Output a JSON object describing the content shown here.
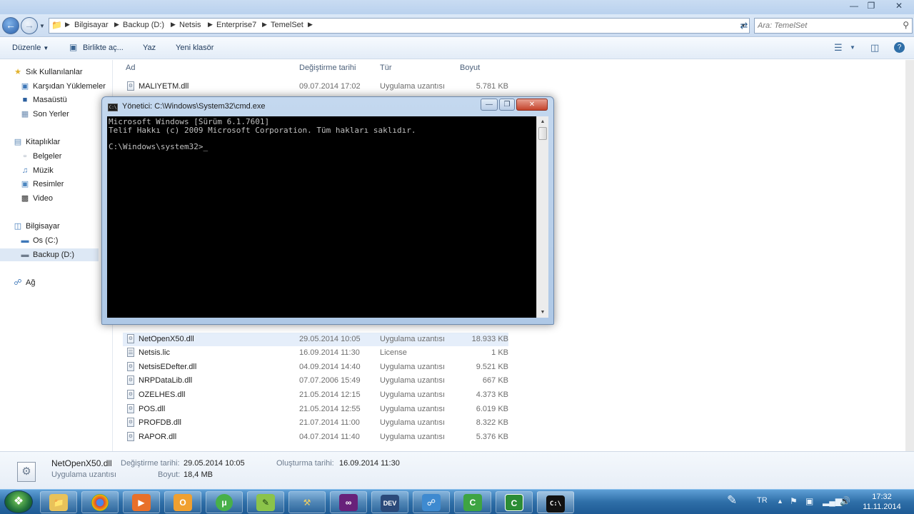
{
  "explorer": {
    "breadcrumbs": [
      "Bilgisayar",
      "Backup (D:)",
      "Netsis",
      "Enterprise7",
      "TemelSet"
    ],
    "search_placeholder": "Ara: TemelSet",
    "toolbar": {
      "organize": "Düzenle",
      "open_with": "Birlikte aç...",
      "print": "Yaz",
      "new_folder": "Yeni klasör"
    },
    "nav": {
      "favorites": "Sık Kullanılanlar",
      "downloads": "Karşıdan Yüklemeler",
      "desktop": "Masaüstü",
      "recent": "Son Yerler",
      "libraries": "Kitaplıklar",
      "documents": "Belgeler",
      "music": "Müzik",
      "pictures": "Resimler",
      "videos": "Video",
      "computer": "Bilgisayar",
      "drive_c": "Os (C:)",
      "drive_d": "Backup (D:)",
      "network": "Ağ"
    },
    "columns": {
      "name": "Ad",
      "date": "Değiştirme tarihi",
      "type": "Tür",
      "size": "Boyut"
    },
    "files": [
      {
        "name": "MALIYETM.dll",
        "date": "09.07.2014 17:02",
        "type": "Uygulama uzantısı",
        "size": "5.781 KB"
      },
      {
        "name": "NetOpenX50.dll",
        "date": "29.05.2014 10:05",
        "type": "Uygulama uzantısı",
        "size": "18.933 KB",
        "selected": true
      },
      {
        "name": "Netsis.lic",
        "date": "16.09.2014 11:30",
        "type": "License",
        "size": "1 KB"
      },
      {
        "name": "NetsisEDefter.dll",
        "date": "04.09.2014 14:40",
        "type": "Uygulama uzantısı",
        "size": "9.521 KB"
      },
      {
        "name": "NRPDataLib.dll",
        "date": "07.07.2006 15:49",
        "type": "Uygulama uzantısı",
        "size": "667 KB"
      },
      {
        "name": "OZELHES.dll",
        "date": "21.05.2014 12:15",
        "type": "Uygulama uzantısı",
        "size": "4.373 KB"
      },
      {
        "name": "POS.dll",
        "date": "21.05.2014 12:55",
        "type": "Uygulama uzantısı",
        "size": "6.019 KB"
      },
      {
        "name": "PROFDB.dll",
        "date": "21.07.2014 11:00",
        "type": "Uygulama uzantısı",
        "size": "8.322 KB"
      },
      {
        "name": "RAPOR.dll",
        "date": "04.07.2014 11:40",
        "type": "Uygulama uzantısı",
        "size": "5.376 KB"
      }
    ],
    "status": {
      "file_name": "NetOpenX50.dll",
      "file_type": "Uygulama uzantısı",
      "modified_label": "Değiştirme tarihi:",
      "modified_value": "29.05.2014 10:05",
      "size_label": "Boyut:",
      "size_value": "18,4 MB",
      "created_label": "Oluşturma tarihi:",
      "created_value": "16.09.2014 11:30"
    }
  },
  "cmd": {
    "title": "Yönetici: C:\\Windows\\System32\\cmd.exe",
    "lines": [
      "Microsoft Windows [Sürüm 6.1.7601]",
      "Telif Hakkı (c) 2009 Microsoft Corporation. Tüm hakları saklıdır.",
      "",
      "C:\\Windows\\system32>_"
    ]
  },
  "taskbar": {
    "apps": [
      "explorer-icon",
      "chrome-icon",
      "media-player-icon",
      "outlook-icon",
      "utorrent-icon",
      "notepadpp-icon",
      "tools-icon",
      "visual-studio-icon",
      "devexpress-icon",
      "network-tool-icon",
      "camtasia-icon",
      "camtasia-recorder-icon",
      "cmd-icon"
    ],
    "language": "TR",
    "time": "17:32",
    "date": "11.11.2014"
  },
  "colors": {
    "taskbar": "#2f6fa8",
    "console_bg": "#000000",
    "console_text": "#c0c0c0",
    "selection": "#e5eefa"
  }
}
